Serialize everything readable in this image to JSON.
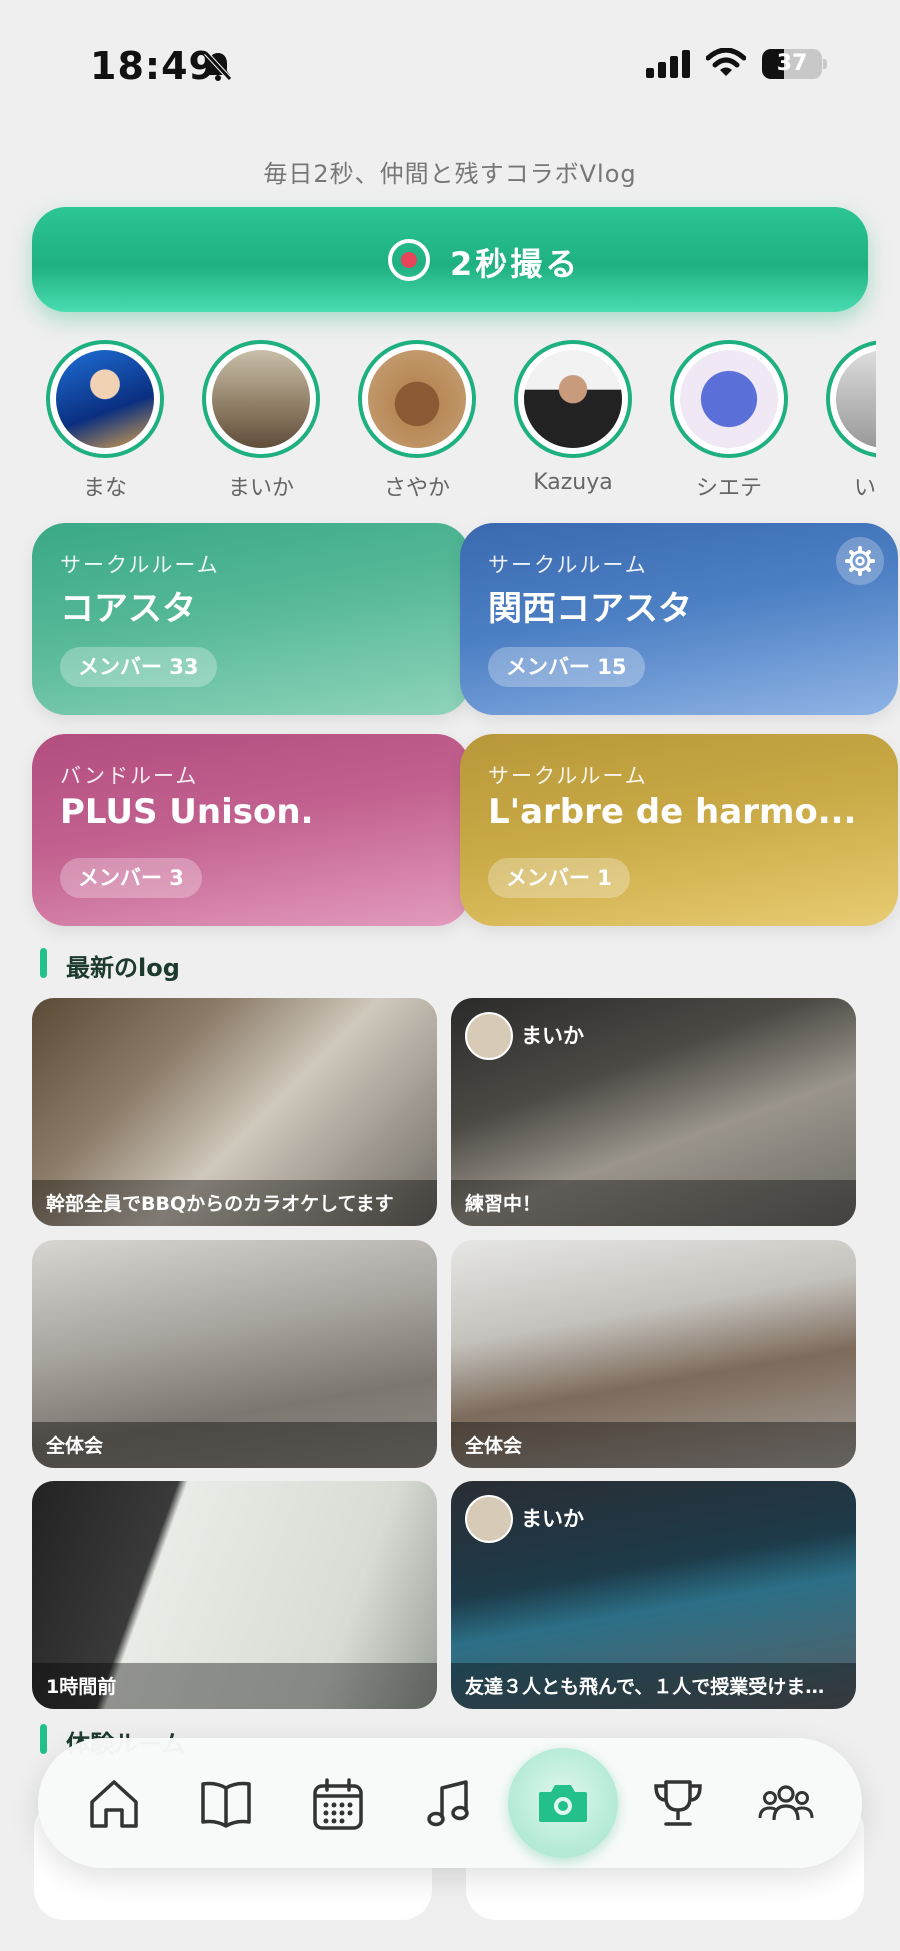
{
  "status_bar": {
    "time": "18:49",
    "battery": "37"
  },
  "tagline": "毎日2秒、仲間と残すコラボVlog",
  "record_button": {
    "label": "2秒撮る"
  },
  "friends": [
    {
      "name": "まな"
    },
    {
      "name": "まいか"
    },
    {
      "name": "さやか"
    },
    {
      "name": "Kazuya"
    },
    {
      "name": "シエテ"
    },
    {
      "name": "い"
    }
  ],
  "rooms": [
    {
      "kind": "サークルルーム",
      "name": "コアスタ",
      "members": "メンバー 33",
      "color": "#3aa886"
    },
    {
      "kind": "サークルルーム",
      "name": "関西コアスタ",
      "members": "メンバー 15",
      "color": "#3f72b8"
    },
    {
      "kind": "バンドルーム",
      "name": "PLUS Unison.",
      "members": "メンバー 3",
      "color": "#b95686"
    },
    {
      "kind": "サークルルーム",
      "name": "L'arbre de harmo...",
      "members": "メンバー 1",
      "color": "#c8a63e"
    }
  ],
  "sections": {
    "latest_log": "最新のlog",
    "next": "体験ルーム"
  },
  "logs": [
    {
      "caption": "幹部全員でBBQからのカラオケしてます",
      "user": ""
    },
    {
      "caption": "練習中！",
      "user": "まいか"
    },
    {
      "caption": "全体会",
      "user": ""
    },
    {
      "caption": "全体会",
      "user": ""
    },
    {
      "caption": "1時間前",
      "user": ""
    },
    {
      "caption": "友達３人とも飛んで、１人で授業受けま…",
      "user": "まいか"
    }
  ],
  "nav": {
    "items": [
      "home-icon",
      "book-icon",
      "calendar-icon",
      "music-note-icon",
      "camera-icon",
      "trophy-icon",
      "group-icon"
    ],
    "accent": "#23c08c"
  }
}
